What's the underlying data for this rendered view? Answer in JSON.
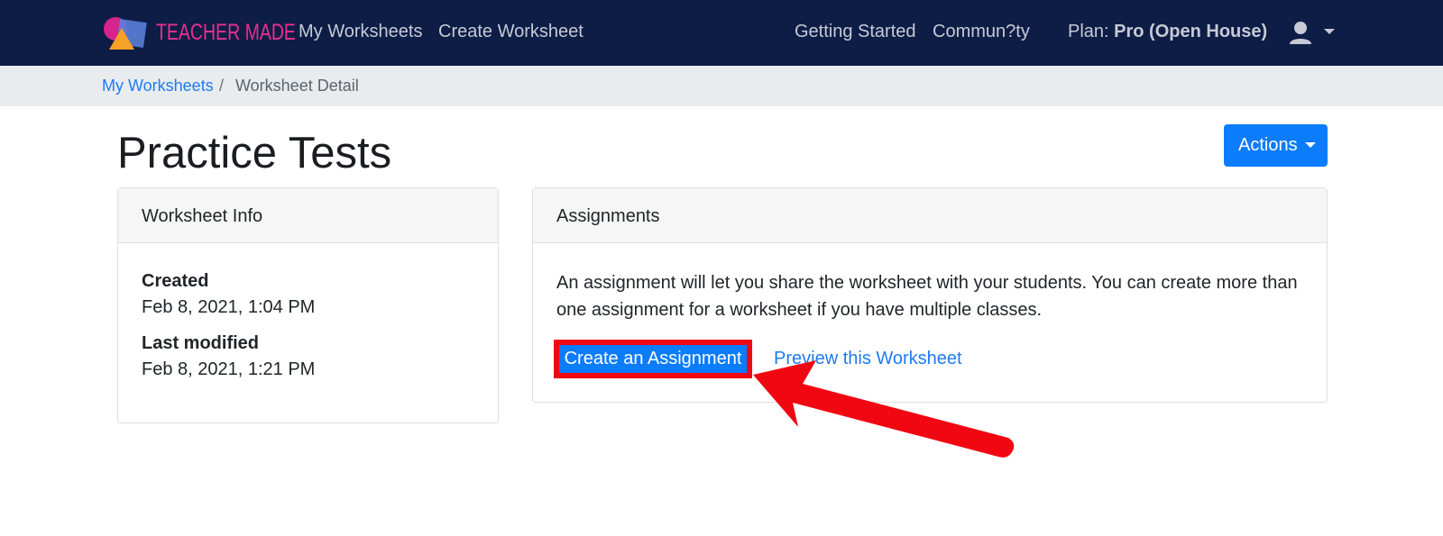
{
  "navbar": {
    "logo_text": "TEACHER MADE",
    "links_left": [
      "My Worksheets",
      "Create Worksheet"
    ],
    "links_right": [
      "Getting Started",
      "Commun?ty"
    ],
    "plan_label": "Plan:",
    "plan_value": "Pro (Open House)"
  },
  "breadcrumb": {
    "link": "My Worksheets",
    "separator": "/",
    "current": "Worksheet Detail"
  },
  "page": {
    "title": "Practice Tests",
    "actions_label": "Actions"
  },
  "worksheet_info": {
    "header": "Worksheet Info",
    "created_label": "Created",
    "created_value": "Feb 8, 2021, 1:04 PM",
    "modified_label": "Last modified",
    "modified_value": "Feb 8, 2021, 1:21 PM"
  },
  "assignments": {
    "header": "Assignments",
    "description": "An assignment will let you share the worksheet with your students. You can create more than one assignment for a worksheet if you have multiple classes.",
    "create_button": "Create an Assignment",
    "preview_link": "Preview this Worksheet"
  },
  "colors": {
    "navbar_bg": "#0e1d46",
    "primary": "#0b7cfc",
    "link": "#1d7bf3",
    "highlight_red": "#f00711",
    "logo_pink": "#e8308f"
  },
  "icons": {
    "user": "user-icon",
    "dropdown": "caret-down-icon",
    "annotation": "red-arrow-icon"
  }
}
